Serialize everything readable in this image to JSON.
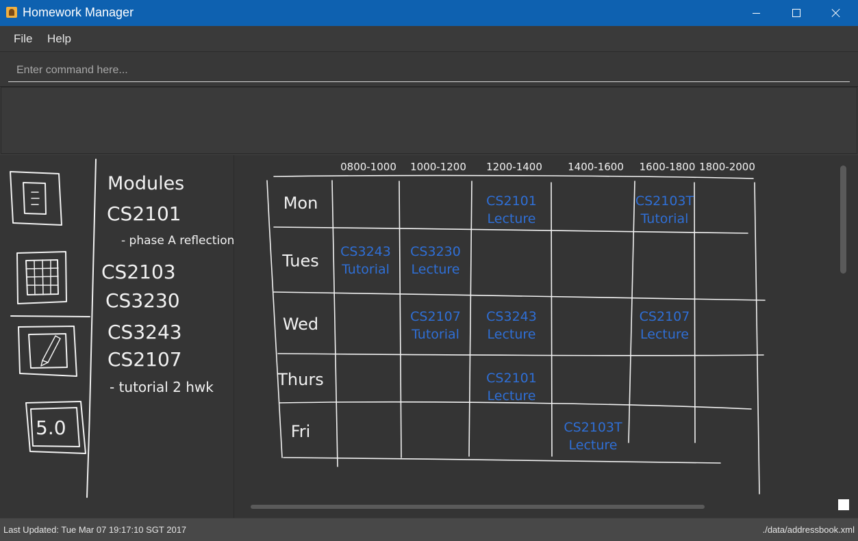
{
  "window": {
    "title": "Homework Manager"
  },
  "menu": {
    "file": "File",
    "help": "Help"
  },
  "command": {
    "placeholder": "Enter command here..."
  },
  "sidebar": {
    "icons": [
      "notes-icon",
      "grid-icon",
      "edit-icon",
      "score-icon"
    ],
    "score_label": "5.0",
    "modules_heading": "Modules",
    "modules": [
      {
        "code": "CS2101",
        "note": "- phase A reflection"
      },
      {
        "code": "CS2103",
        "note": ""
      },
      {
        "code": "CS3230",
        "note": ""
      },
      {
        "code": "CS3243",
        "note": ""
      },
      {
        "code": "CS2107",
        "note": "- tutorial 2 hwk"
      }
    ]
  },
  "timetable": {
    "time_slots": [
      "0800-1000",
      "1000-1200",
      "1200-1400",
      "1400-1600",
      "1600-1800",
      "1800-2000"
    ],
    "days": [
      "Mon",
      "Tues",
      "Wed",
      "Thurs",
      "Fri"
    ],
    "entries": [
      {
        "day": "Mon",
        "slot": "1200-1400",
        "module": "CS2101",
        "type": "Lecture"
      },
      {
        "day": "Mon",
        "slot": "1600-1800",
        "module": "CS2103T",
        "type": "Tutorial"
      },
      {
        "day": "Tues",
        "slot": "0800-1000",
        "module": "CS3243",
        "type": "Tutorial"
      },
      {
        "day": "Tues",
        "slot": "1000-1200",
        "module": "CS3230",
        "type": "Lecture"
      },
      {
        "day": "Wed",
        "slot": "1000-1200",
        "module": "CS2107",
        "type": "Tutorial"
      },
      {
        "day": "Wed",
        "slot": "1200-1400",
        "module": "CS3243",
        "type": "Lecture"
      },
      {
        "day": "Wed",
        "slot": "1600-1800",
        "module": "CS2107",
        "type": "Lecture"
      },
      {
        "day": "Thurs",
        "slot": "1200-1400",
        "module": "CS2101",
        "type": "Lecture"
      },
      {
        "day": "Fri",
        "slot": "1400-1600",
        "module": "CS2103T",
        "type": "Lecture"
      }
    ],
    "ink_colors": {
      "grid": "#f2f2f2",
      "entries": "#2f6fd6"
    }
  },
  "status": {
    "last_updated": "Last Updated: Tue Mar 07 19:17:10 SGT 2017",
    "file_path": "./data/addressbook.xml"
  },
  "colors": {
    "titlebar": "#0e61b0",
    "background": "#3a3a3a",
    "statusbar": "#484848"
  }
}
